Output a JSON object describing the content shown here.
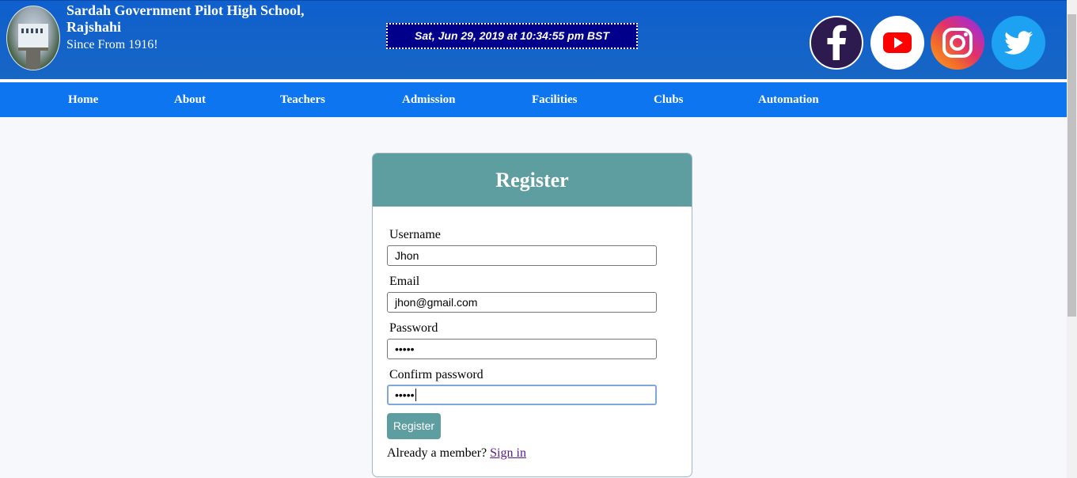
{
  "header": {
    "school_name": "Sardah Government Pilot High School, Rajshahi",
    "since": "Since From 1916!",
    "datetime": "Sat, Jun 29, 2019 at 10:34:55 pm BST"
  },
  "social": [
    {
      "name": "facebook-icon",
      "color": "#2d1a4f"
    },
    {
      "name": "youtube-icon",
      "color": "#ff0000"
    },
    {
      "name": "instagram-icon",
      "color": "#e1306c"
    },
    {
      "name": "twitter-icon",
      "color": "#1da1f2"
    }
  ],
  "nav": {
    "home": "Home",
    "about": "About",
    "teachers": "Teachers",
    "admission": "Admission",
    "facilities": "Facilities",
    "clubs": "Clubs",
    "automation": "Automation"
  },
  "form": {
    "title": "Register",
    "username_label": "Username",
    "username_value": "Jhon",
    "email_label": "Email",
    "email_value": "jhon@gmail.com",
    "password_label": "Password",
    "password_value": "•••••",
    "confirm_label": "Confirm password",
    "confirm_value": "•••••",
    "submit_label": "Register",
    "member_text": "Already a member?",
    "signin_label": "Sign in"
  },
  "colors": {
    "header_bg": "#1260c8",
    "nav_bg": "#0d75f0",
    "clock_bg": "#00008b",
    "accent": "#5f9ea0"
  }
}
